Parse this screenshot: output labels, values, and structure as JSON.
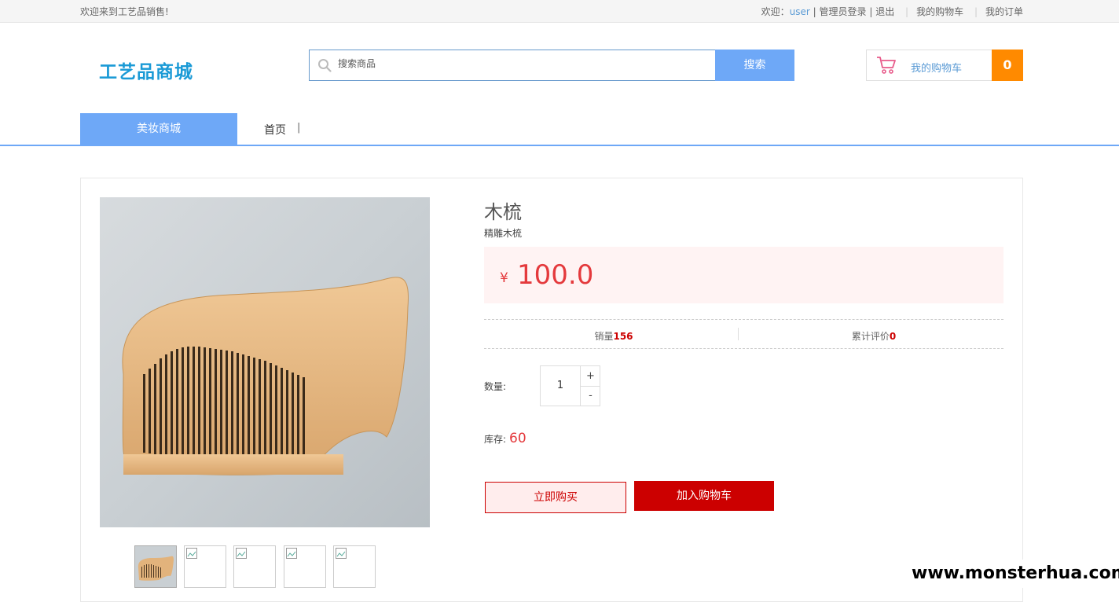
{
  "topbar": {
    "welcome": "欢迎来到工艺品销售!",
    "greeting_prefix": "欢迎：",
    "username": "user",
    "admin_login": "管理员登录",
    "logout": "退出",
    "my_cart": "我的购物车",
    "my_orders": "我的订单"
  },
  "header": {
    "logo": "工艺品商城",
    "search_placeholder": "搜索商品",
    "search_button": "搜索",
    "cart_label": "我的购物车",
    "cart_count": "0"
  },
  "nav": {
    "category": "美妆商城",
    "home": "首页",
    "divider": "|"
  },
  "product": {
    "name": "木梳",
    "subtitle": "精雕木梳",
    "currency": "¥",
    "price": "100.0",
    "sales_label": "销量",
    "sales": "156",
    "reviews_label": "累计评价",
    "reviews": "0",
    "quantity_label": "数量:",
    "quantity": "1",
    "plus": "+",
    "minus": "-",
    "stock_label": "库存:",
    "stock": "60",
    "buy_now": "立即购买",
    "add_to_cart": "加入购物车"
  },
  "watermark": "www.monsterhua.com"
}
